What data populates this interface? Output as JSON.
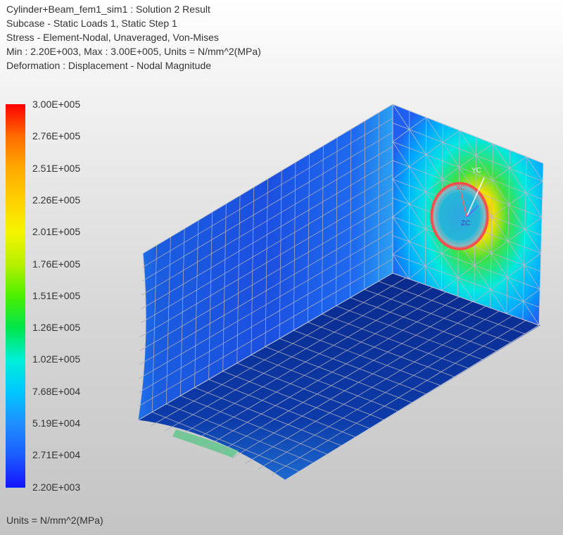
{
  "header": {
    "line1": "Cylinder+Beam_fem1_sim1 : Solution 2 Result",
    "line2": "Subcase - Static Loads 1, Static Step 1",
    "line3": "Stress - Element-Nodal, Unaveraged, Von-Mises",
    "line4": "Min : 2.20E+003, Max : 3.00E+005, Units = N/mm^2(MPa)",
    "line5": "Deformation : Displacement - Nodal Magnitude"
  },
  "legend": {
    "labels": [
      "3.00E+005",
      "2.76E+005",
      "2.51E+005",
      "2.26E+005",
      "2.01E+005",
      "1.76E+005",
      "1.51E+005",
      "1.26E+005",
      "1.02E+005",
      "7.68E+004",
      "5.19E+004",
      "2.71E+004",
      "2.20E+003"
    ],
    "colors": [
      "#ff0000",
      "#ff6a00",
      "#ffaa00",
      "#ffd000",
      "#f5f500",
      "#b8f000",
      "#4cf000",
      "#00e54a",
      "#00f0d8",
      "#00c8ff",
      "#1e90ff",
      "#1c5cff",
      "#1414ff"
    ]
  },
  "axis_labels": {
    "yc": "YC",
    "zc": "ZC",
    "xc": "XC"
  },
  "footer": {
    "units": "Units = N/mm^2(MPa)"
  }
}
